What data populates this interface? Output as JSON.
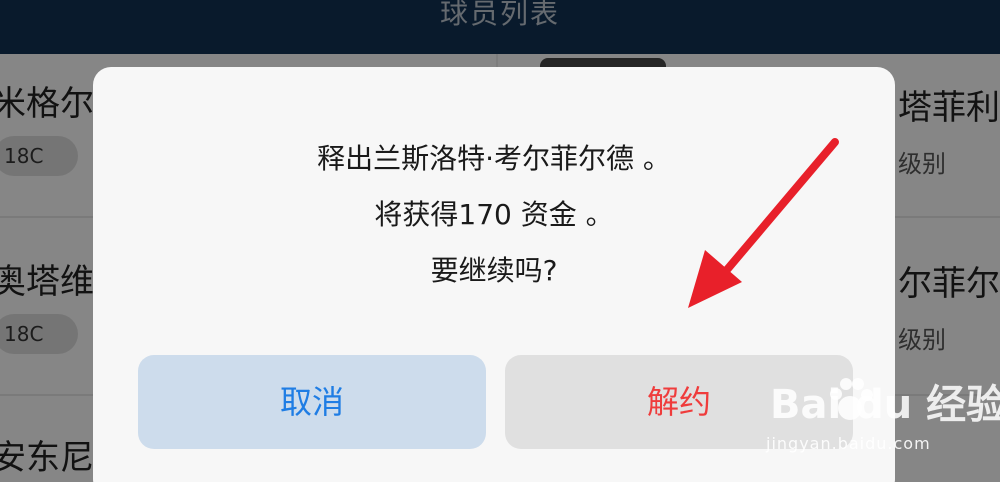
{
  "header": {
    "title": "球员列表"
  },
  "list": {
    "left_players": [
      {
        "name": "米格尔",
        "rating": "18C"
      },
      {
        "name": "奥塔维",
        "rating": "18C"
      },
      {
        "name": "安东尼"
      }
    ],
    "right_players": [
      {
        "name": "塔菲利",
        "level_label": "级别"
      },
      {
        "name": "尔菲尔",
        "level_label": "级别"
      }
    ]
  },
  "dialog": {
    "line1": "释出兰斯洛特·考尔菲尔德 。",
    "line2": "将获得170 资金 。",
    "line3": "要继续吗?",
    "cancel_label": "取消",
    "release_label": "解约"
  },
  "annotation": {
    "arrow_color": "#e8202a"
  },
  "watermark": {
    "logo": "Bai du 经验",
    "url": "jingyan.baidu.com"
  },
  "colors": {
    "header_bg": "#123150",
    "cancel_bg": "#cddcec",
    "cancel_text": "#1f7de4",
    "release_bg": "#e0e0e0",
    "release_text": "#ef3c3c"
  }
}
